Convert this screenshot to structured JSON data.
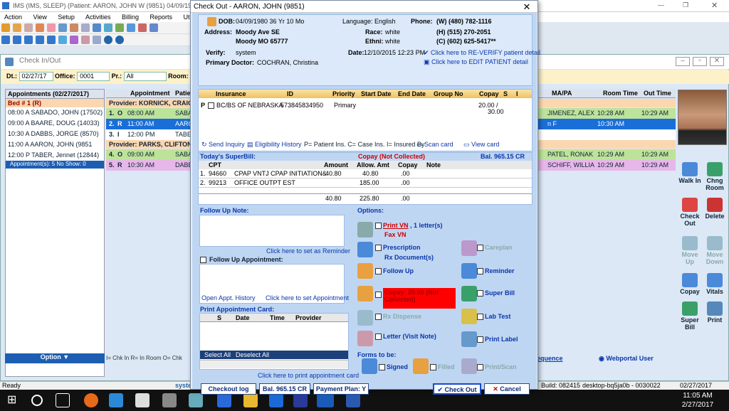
{
  "app": {
    "title": "IMS (IMS, SLEEP)",
    "patient": "(Patient: AARON, JOHN W (9851) 04/09/198",
    "menu": [
      "Action",
      "View",
      "Setup",
      "Activities",
      "Billing",
      "Reports",
      "Utilities"
    ]
  },
  "checkin": {
    "title": "Check In/Out",
    "dt_label": "Dt.:",
    "dt": "02/27/17",
    "office_label": "Office:",
    "office": "0001",
    "pr_label": "Pr.:",
    "pr": "All",
    "room_label": "Room:",
    "left_header": "Appointments (02/27/2017)",
    "bed": "Bed # 1 (R)",
    "left_rows": [
      "08:00 A  SABADO, JOHN (17502)",
      "09:00 A  BAARE, DOUG (14033)",
      "10:30 A  DABBS, JORGE (8570)",
      "11:00 A  AARON, JOHN (9851",
      "12:00 P  TABER, Jennet (12844)"
    ],
    "count": "Appointment(s): 5   No Show: 0",
    "grid_cols": [
      "Appointment",
      "Patie",
      "MA/PA",
      "Room Time",
      "Out Time"
    ],
    "prov1": "Provider: KORNICK, CRAIG",
    "prov2": "Provider: PARKS, CLIFTON",
    "rows": [
      {
        "n": "1.",
        "s": "O",
        "t": "08:00 AM",
        "p": "SABA",
        "ma": "JIMENEZ, ALEX",
        "rt": "10:28 AM",
        "ot": "10:29 AM",
        "c": "#bde39a"
      },
      {
        "n": "2.",
        "s": "R",
        "t": "11:00 AM",
        "p": "AARO",
        "ma": "n F",
        "rt": "10:30 AM",
        "ot": "",
        "c": "#1a6ed8"
      },
      {
        "n": "3.",
        "s": "I",
        "t": "12:00 PM",
        "p": "TABER",
        "ma": "",
        "rt": "",
        "ot": "",
        "c": "#fff"
      },
      {
        "n": "4.",
        "s": "O",
        "t": "09:00 AM",
        "p": "SABA",
        "ma": "PATEL, RONAK",
        "rt": "10:29 AM",
        "ot": "10:29 AM",
        "c": "#bde39a"
      },
      {
        "n": "5.",
        "s": "R",
        "t": "10:30 AM",
        "p": "DABB",
        "ma": "SCHIFF, WILLIA",
        "rt": "10:29 AM",
        "ot": "10:29 AM",
        "c": "#e7b7e9"
      }
    ],
    "legend": "I= Chk In  R= In Room O= Chk",
    "option": "Option",
    "right_buttons": [
      [
        "Walk In",
        "Chng Room"
      ],
      [
        "Check Out",
        "Delete"
      ],
      [
        "Move Up",
        "Move Down"
      ],
      [
        "Copay",
        "Vitals"
      ],
      [
        "Super Bill",
        "Print"
      ]
    ],
    "sequence": "equence",
    "webportal": "Webportal User"
  },
  "status": {
    "left": "Ready",
    "sys": "syste",
    "build": "Build: 082415",
    "desktop": "desktop-bq5ja0b - 0030022",
    "date": "02/27/2017"
  },
  "taskbar": {
    "time": "11:05 AM",
    "date": "2/27/2017"
  },
  "dialog": {
    "title": "Check Out - AARON, JOHN  (9851)",
    "dob_label": "DOB:",
    "dob": "04/09/1980  36 Yr 10 Mo",
    "lang": "Language: English",
    "phone_label": "Phone:",
    "phone_w": "(W)  (480) 782-1116",
    "phone_h": "(H)  (515) 270-2051",
    "phone_c": "(C)  (602) 625-5417**",
    "addr_label": "Address:",
    "addr1": "Moody Ave SE",
    "addr2": "Moody   MO   65777",
    "race_label": "Race:",
    "race": "white",
    "ethni_label": "Ethni:",
    "ethni": "white",
    "verify_label": "Verify:",
    "verify": "system",
    "date_label": "Date:",
    "date": "12/10/2015 12:23 PM",
    "reverify": "Click here to RE-VERIFY patient detail",
    "editpat": "Click here to EDIT PATIENT detail",
    "prim_label": "Primary Doctor:",
    "prim": "COCHRAN, Christina",
    "ins_cols": [
      "Insurance",
      "ID",
      "Priority",
      "Start Date",
      "End Date",
      "Group No",
      "Copay",
      "S",
      "I"
    ],
    "ins_row": {
      "p": "P",
      "ins": "BC/BS OF NEBRASKA",
      "id": "573845834950",
      "pri": "Primary",
      "copay": "20.00 /",
      "copay2": "30.00"
    },
    "ins_links": [
      "Send Inquiry",
      "Eligibility History",
      "P= Patient Ins. C= Case Ins. I= Insured By",
      "Scan card",
      "View card"
    ],
    "sb_label": "Today's SuperBill:",
    "sb_copay": "Copay (Not Collected)",
    "sb_bal": "Bal. 965.15 CR",
    "sb_cols": [
      "CPT",
      "Amount",
      "Allow. Amt",
      "Copay",
      "Note"
    ],
    "sb_rows": [
      [
        "1.",
        "94660",
        "CPAP VNTJ CPAP INITIATION&",
        "40.80",
        "40.80",
        ".00"
      ],
      [
        "2.",
        "99213",
        "OFFICE OUTPT EST",
        "",
        "185.00",
        ".00"
      ]
    ],
    "sb_total": [
      "40.80",
      "225.80",
      ".00"
    ],
    "fu_note": "Follow Up Note:",
    "fu_rem": "Click here to set as Reminder",
    "fu_appt": "Follow Up Appointment:",
    "fu_hist": "Open Appt. History",
    "fu_set": "Click here to set Appointment",
    "pac": "Print Appointment Card:",
    "pac_cols": [
      "S",
      "Date",
      "Time",
      "Provider"
    ],
    "sel_all": "Select All",
    "desel_all": "Deselect All",
    "pac_link": "Click here to print appointment card",
    "options": "Options:",
    "print_vn": "Print VN",
    "letters": ", 1 letter(s)",
    "fax_vn": "Fax VN",
    "careplan": "Careplan",
    "prescription": "Prescription",
    "rxdoc": "Rx Document(s)",
    "followup": "Follow Up",
    "reminder": "Reminder",
    "copay_box": "Copay: 20.00 (Not Collected)",
    "superbill": "Super Bill",
    "rxdisp": "Rx Dispense",
    "labtest": "Lab Test",
    "letter": "Letter (Visit Note)",
    "printlabel": "Print Label",
    "forms": "Forms to be:",
    "signed": "Signed",
    "filled": "Filled",
    "printscan": "Print/Scan",
    "checkout_log": "Checkout log",
    "bal": "Bal.  965.15 CR",
    "payplan": "Payment Plan: Y",
    "checkout": "Check Out",
    "cancel": "Cancel"
  }
}
